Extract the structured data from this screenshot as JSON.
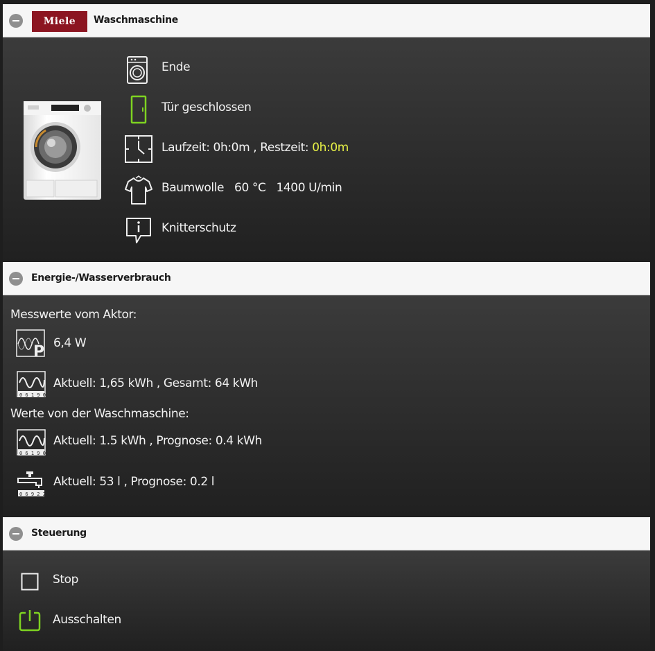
{
  "colors": {
    "accent": "#7ed321",
    "highlight": "#e6f046",
    "brand": "#8c1521"
  },
  "device": {
    "brand_logo": "Miele",
    "title": "Waschmaschine",
    "status": "Ende",
    "door": "Tür geschlossen",
    "laufzeit_label": "Laufzeit: 0h:0m , Restzeit: ",
    "restzeit_value": "0h:0m",
    "program": "Baumwolle",
    "temperature": "60 °C",
    "spin": "1400 U/min",
    "phase": "Knitterschutz"
  },
  "energy": {
    "title": "Energie-/Wasserverbrauch",
    "actor_heading": "Messwerte vom Aktor:",
    "power": "6,4 W",
    "actor_energy": "Aktuell: 1,65 kWh , Gesamt: 64 kWh",
    "machine_heading": "Werte von der Waschmaschine:",
    "machine_energy": "Aktuell: 1.5 kWh , Prognose: 0.4 kWh",
    "machine_water": "Aktuell: 53 l , Prognose: 0.2 l",
    "meter_digits_energy": "0 6 1 9 0 3 9 6",
    "meter_digits_water": "0 6 9 2 2 0 3 0"
  },
  "control": {
    "title": "Steuerung",
    "stop": "Stop",
    "off": "Ausschalten"
  }
}
